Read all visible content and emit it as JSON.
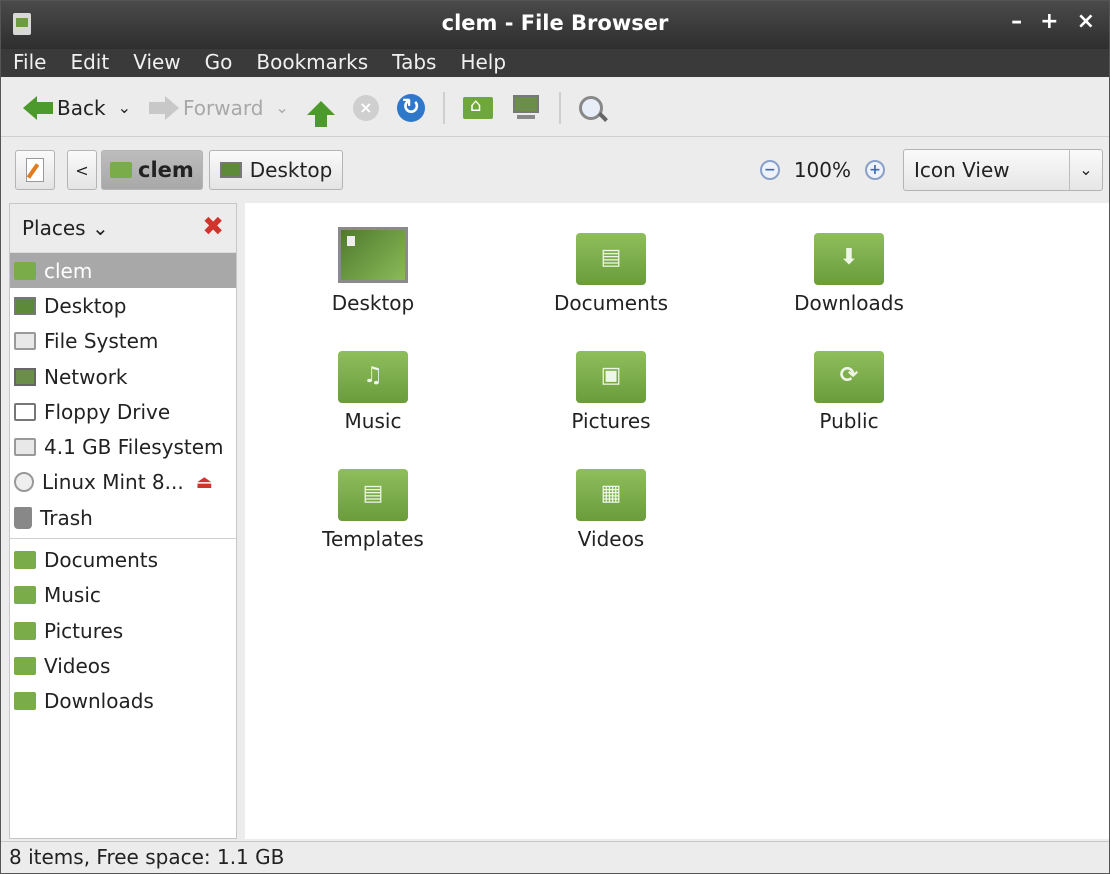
{
  "window": {
    "title": "clem - File Browser",
    "min": "–",
    "max": "+",
    "close": "×"
  },
  "menu": [
    "File",
    "Edit",
    "View",
    "Go",
    "Bookmarks",
    "Tabs",
    "Help"
  ],
  "toolbar": {
    "back": "Back",
    "forward": "Forward"
  },
  "location": {
    "crumbs": [
      "clem",
      "Desktop"
    ],
    "back_chevron": "<",
    "zoom": "100%",
    "view": "Icon View"
  },
  "sidebar": {
    "header": "Places",
    "places": [
      {
        "label": "clem",
        "icon": "home-folder-icon"
      },
      {
        "label": "Desktop",
        "icon": "desktop-icon"
      },
      {
        "label": "File System",
        "icon": "drive-icon"
      },
      {
        "label": "Network",
        "icon": "network-icon"
      },
      {
        "label": "Floppy Drive",
        "icon": "floppy-icon"
      },
      {
        "label": "4.1 GB Filesystem",
        "icon": "drive-icon"
      },
      {
        "label": "Linux Mint 8...",
        "icon": "cd-icon"
      },
      {
        "label": "Trash",
        "icon": "trash-icon"
      }
    ],
    "bookmarks": [
      "Documents",
      "Music",
      "Pictures",
      "Videos",
      "Downloads"
    ]
  },
  "files": [
    {
      "name": "Desktop",
      "glyph": ""
    },
    {
      "name": "Documents",
      "glyph": "▤"
    },
    {
      "name": "Downloads",
      "glyph": "⬇"
    },
    {
      "name": "Music",
      "glyph": "♫"
    },
    {
      "name": "Pictures",
      "glyph": "▣"
    },
    {
      "name": "Public",
      "glyph": "⟳"
    },
    {
      "name": "Templates",
      "glyph": "▤"
    },
    {
      "name": "Videos",
      "glyph": "▦"
    }
  ],
  "status": "8 items, Free space: 1.1 GB",
  "colors": {
    "folder": "#7aac4a",
    "accent_green": "#4d9a2c",
    "titlebar": "#3a3a3a"
  }
}
